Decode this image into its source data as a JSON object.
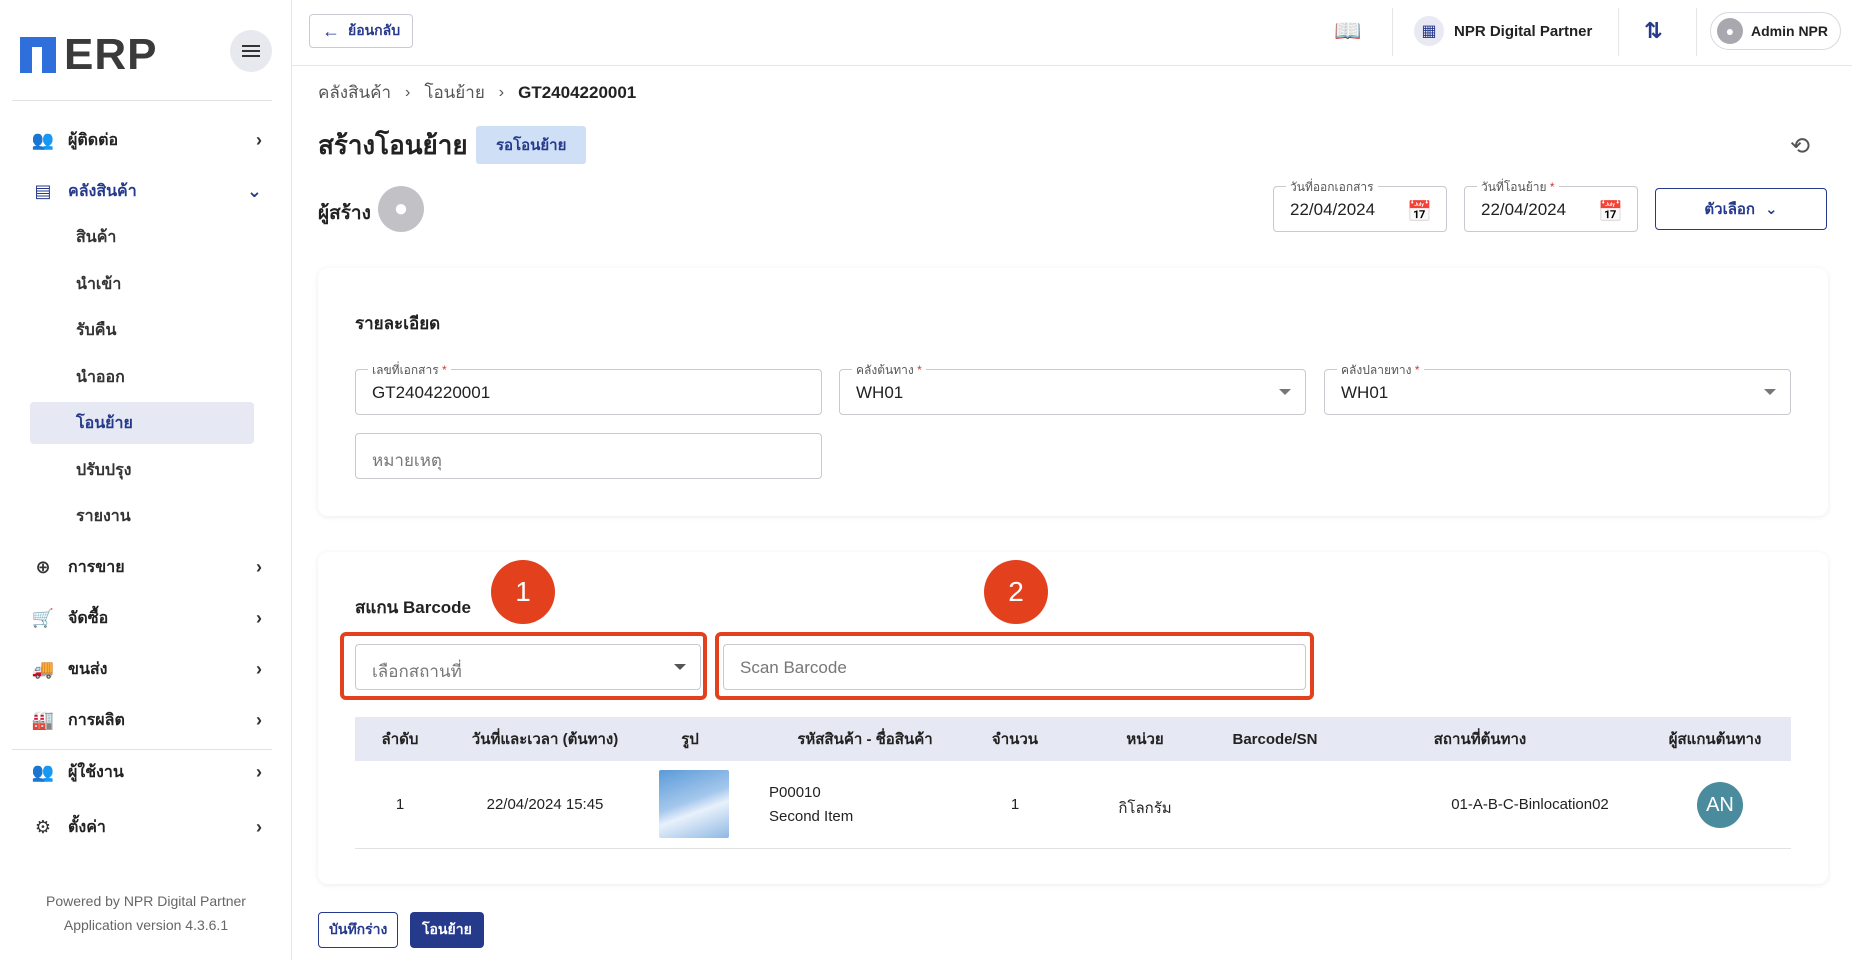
{
  "app": {
    "logo_text": "ERP",
    "powered_by": "Powered by NPR Digital Partner",
    "version": "Application version 4.3.6.1"
  },
  "sidebar": {
    "items": [
      {
        "label": "ผู้ติดต่อ",
        "icon": "contacts-icon"
      },
      {
        "label": "คลังสินค้า",
        "icon": "warehouse-icon",
        "expanded": true
      },
      {
        "label": "การขาย",
        "icon": "plus-circle-icon"
      },
      {
        "label": "จัดซื้อ",
        "icon": "cart-icon"
      },
      {
        "label": "ขนส่ง",
        "icon": "truck-icon"
      },
      {
        "label": "การผลิต",
        "icon": "factory-icon"
      },
      {
        "label": "ผู้ใช้งาน",
        "icon": "users-icon"
      },
      {
        "label": "ตั้งค่า",
        "icon": "gear-icon"
      }
    ],
    "subitems": [
      "สินค้า",
      "นำเข้า",
      "รับคืน",
      "นำออก",
      "โอนย้าย",
      "ปรับปรุง",
      "รายงาน"
    ],
    "selected_subitem": "โอนย้าย"
  },
  "topbar": {
    "back_label": "ย้อนกลับ",
    "company": "NPR Digital Partner",
    "user": "Admin NPR"
  },
  "breadcrumb": [
    "คลังสินค้า",
    "โอนย้าย",
    "GT2404220001"
  ],
  "page": {
    "title": "สร้างโอนย้าย",
    "status": "รอโอนย้าย",
    "creator_label": "ผู้สร้าง",
    "issue_date_label": "วันที่ออกเอกสาร",
    "issue_date": "22/04/2024",
    "transfer_date_label": "วันที่โอนย้าย",
    "transfer_date": "22/04/2024",
    "options_label": "ตัวเลือก"
  },
  "details": {
    "title": "รายละเอียด",
    "doc_no_label": "เลขที่เอกสาร",
    "doc_no": "GT2404220001",
    "source_label": "คลังต้นทาง",
    "source": "WH01",
    "dest_label": "คลังปลายทาง",
    "dest": "WH01",
    "remark_placeholder": "หมายเหตุ"
  },
  "scan": {
    "title": "สแกน Barcode",
    "location_placeholder": "เลือกสถานที่",
    "barcode_placeholder": "Scan Barcode",
    "markers": [
      "1",
      "2"
    ]
  },
  "table": {
    "headers": [
      "ลำดับ",
      "วันที่และเวลา (ต้นทาง)",
      "รูป",
      "รหัสสินค้า - ชื่อสินค้า",
      "จำนวน",
      "หน่วย",
      "Barcode/SN",
      "สถานที่ต้นทาง",
      "ผู้สแกนต้นทาง"
    ],
    "rows": [
      {
        "no": "1",
        "datetime": "22/04/2024 15:45",
        "code": "P00010",
        "name": "Second Item",
        "qty": "1",
        "unit": "กิโลกรัม",
        "barcode": "",
        "location": "01-A-B-C-Binlocation02",
        "scanner": "AN"
      }
    ]
  },
  "actions": {
    "draft": "บันทึกร่าง",
    "transfer": "โอนย้าย"
  },
  "colors": {
    "primary": "#263a8c",
    "highlight": "#e3401e",
    "badge_bg": "#cfe0f6"
  }
}
